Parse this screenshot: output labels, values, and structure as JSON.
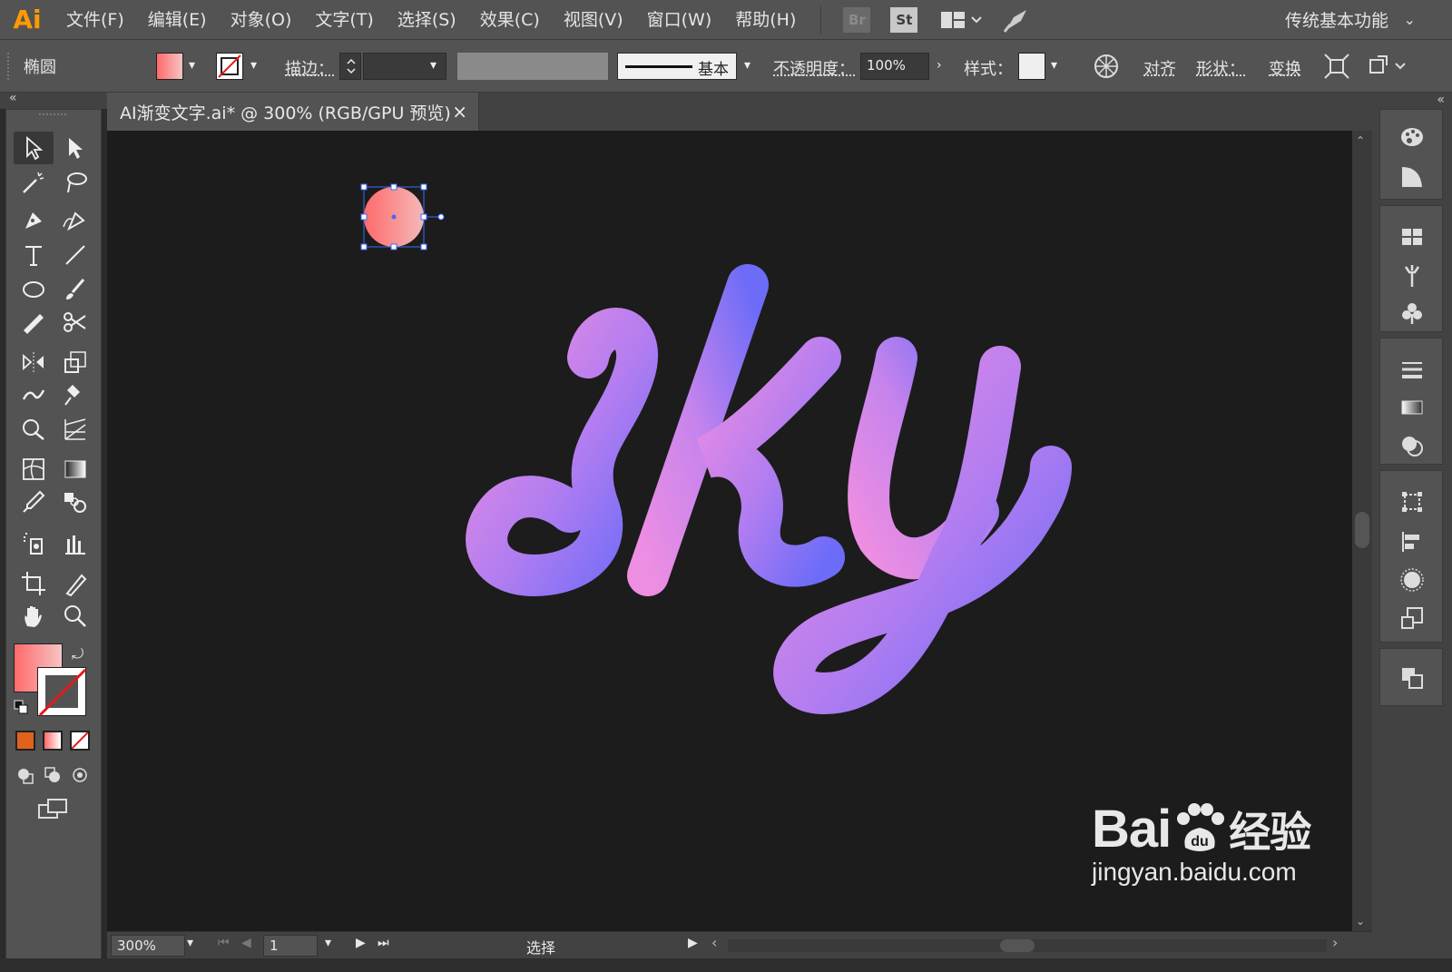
{
  "app": {
    "logo": "Ai",
    "workspace": "传统基本功能"
  },
  "menu": [
    "文件(F)",
    "编辑(E)",
    "对象(O)",
    "文字(T)",
    "选择(S)",
    "效果(C)",
    "视图(V)",
    "窗口(W)",
    "帮助(H)"
  ],
  "bridge_badges": {
    "br": "Br",
    "st": "St"
  },
  "control_bar": {
    "object_type": "椭圆",
    "stroke_label": "描边：",
    "stroke_profile": "基本",
    "opacity_label": "不透明度：",
    "opacity_value": "100%",
    "style_label": "样式：",
    "align_label": "对齐",
    "shape_label": "形状：",
    "transform_label": "变换"
  },
  "document": {
    "tab_title": "AI渐变文字.ai* @ 300% (RGB/GPU 预览)",
    "close": "×"
  },
  "artwork": {
    "text": "sky",
    "gradient_colors": [
      "#ee8ee2",
      "#6c6cf8"
    ],
    "selected_ellipse_gradient": [
      "#ff6a6a",
      "#f4b9b9"
    ]
  },
  "status_bar": {
    "zoom": "300%",
    "page": "1",
    "status": "选择"
  },
  "watermark": {
    "brand": "Bai",
    "brand_suffix": "经验",
    "url": "jingyan.baidu.com"
  },
  "colors": {
    "accent_orange": "#ff9a00",
    "fill_orange": "#e0621b",
    "panel": "#535353",
    "canvas": "#1c1c1c"
  }
}
